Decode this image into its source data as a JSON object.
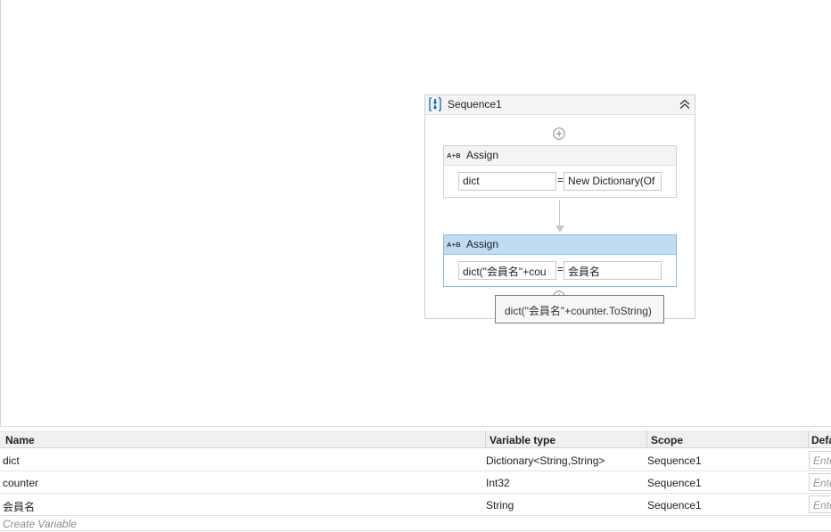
{
  "sequence": {
    "title": "Sequence1",
    "icon": "sequence-icon",
    "collapse_icon": "double-chevron-up-icon"
  },
  "activities": [
    {
      "title": "Assign",
      "icon": "assign-ab-icon",
      "icon_text": "A+B",
      "left": "dict",
      "right": "New Dictionary(Of",
      "selected": false
    },
    {
      "title": "Assign",
      "icon": "assign-ab-icon",
      "icon_text": "A+B",
      "left": "dict(\"会員名\"+cou",
      "right": "会員名",
      "selected": true
    }
  ],
  "equals": "=",
  "tooltip": "dict(\"会員名\"+counter.ToString)",
  "variables": {
    "columns": [
      "Name",
      "Variable type",
      "Scope",
      "Default"
    ],
    "columns_visible": [
      "Name",
      "Variable type",
      "Scope",
      "Defa"
    ],
    "rows": [
      {
        "name": "dict",
        "type": "Dictionary<String,String>",
        "scope": "Sequence1",
        "default": "Enter"
      },
      {
        "name": "counter",
        "type": "Int32",
        "scope": "Sequence1",
        "default": "Enter"
      },
      {
        "name": "会員名",
        "type": "String",
        "scope": "Sequence1",
        "default": "Enter"
      }
    ],
    "create_label": "Create Variable"
  },
  "colors": {
    "selected_header": "#c0dcf3",
    "selected_border": "#8fb6d8",
    "sequence_icon_blue": "#1f6fc5"
  }
}
